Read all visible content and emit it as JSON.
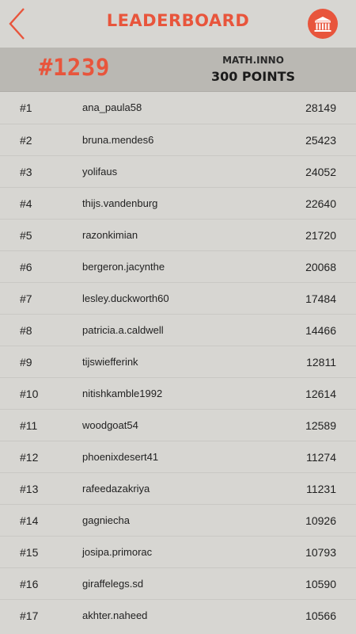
{
  "header": {
    "title": "LEADERBOARD",
    "accent_color": "#e8553c",
    "back_icon": "chevron-left-icon",
    "museum_icon": "museum-icon"
  },
  "summary": {
    "my_rank": "#1239",
    "user_name": "MATH.INNO",
    "points": "300 POINTS"
  },
  "leaderboard": [
    {
      "rank": "#1",
      "name": "ana_paula58",
      "score": "28149"
    },
    {
      "rank": "#2",
      "name": "bruna.mendes6",
      "score": "25423"
    },
    {
      "rank": "#3",
      "name": "yolifaus",
      "score": "24052"
    },
    {
      "rank": "#4",
      "name": "thijs.vandenburg",
      "score": "22640"
    },
    {
      "rank": "#5",
      "name": "razonkimian",
      "score": "21720"
    },
    {
      "rank": "#6",
      "name": "bergeron.jacynthe",
      "score": "20068"
    },
    {
      "rank": "#7",
      "name": "lesley.duckworth60",
      "score": "17484"
    },
    {
      "rank": "#8",
      "name": "patricia.a.caldwell",
      "score": "14466"
    },
    {
      "rank": "#9",
      "name": "tijswiefferink",
      "score": "12811"
    },
    {
      "rank": "#10",
      "name": "nitishkamble1992",
      "score": "12614"
    },
    {
      "rank": "#11",
      "name": "woodgoat54",
      "score": "12589"
    },
    {
      "rank": "#12",
      "name": "phoenixdesert41",
      "score": "11274"
    },
    {
      "rank": "#13",
      "name": "rafeedazakriya",
      "score": "11231"
    },
    {
      "rank": "#14",
      "name": "gagniecha",
      "score": "10926"
    },
    {
      "rank": "#15",
      "name": "josipa.primorac",
      "score": "10793"
    },
    {
      "rank": "#16",
      "name": "giraffelegs.sd",
      "score": "10590"
    },
    {
      "rank": "#17",
      "name": "akhter.naheed",
      "score": "10566"
    }
  ]
}
